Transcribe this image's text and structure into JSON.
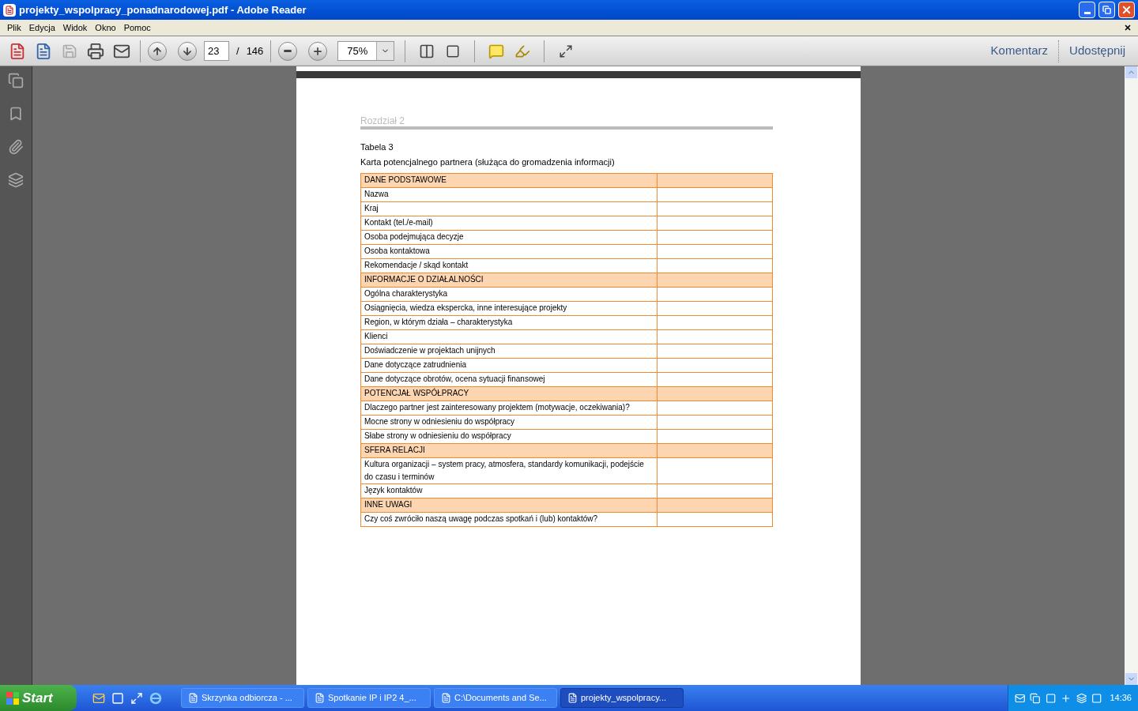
{
  "window": {
    "title": "projekty_wspolpracy_ponadnarodowej.pdf - Adobe Reader"
  },
  "menu": [
    "Plik",
    "Edycja",
    "Widok",
    "Okno",
    "Pomoc"
  ],
  "toolbar": {
    "page": "23",
    "page_separator": "/",
    "page_count": "146",
    "zoom": "75%",
    "links": [
      "Komentarz",
      "Udostępnij"
    ]
  },
  "document": {
    "chapter": "Rozdział 2",
    "table_label": "Tabela 3",
    "table_title": "Karta potencjalnego partnera (służąca do gromadzenia informacji)",
    "rows": [
      {
        "kind": "section",
        "text": "DANE PODSTAWOWE"
      },
      {
        "kind": "item",
        "text": "Nazwa"
      },
      {
        "kind": "item",
        "text": "Kraj"
      },
      {
        "kind": "item",
        "text": "Kontakt (tel./e-mail)"
      },
      {
        "kind": "item",
        "text": "Osoba podejmująca decyzje"
      },
      {
        "kind": "item",
        "text": "Osoba kontaktowa"
      },
      {
        "kind": "item",
        "text": "Rekomendacje / skąd kontakt"
      },
      {
        "kind": "section",
        "text": "INFORMACJE O DZIAŁALNOŚCI"
      },
      {
        "kind": "item",
        "text": "Ogólna charakterystyka"
      },
      {
        "kind": "item",
        "text": "Osiągnięcia, wiedza ekspercka, inne interesujące projekty"
      },
      {
        "kind": "item",
        "text": "Region, w którym działa – charakterystyka"
      },
      {
        "kind": "item",
        "text": "Klienci"
      },
      {
        "kind": "item",
        "text": "Doświadczenie w projektach unijnych"
      },
      {
        "kind": "item",
        "text": "Dane dotyczące zatrudnienia"
      },
      {
        "kind": "item",
        "text": "Dane dotyczące obrotów, ocena sytuacji finansowej"
      },
      {
        "kind": "section",
        "text": "POTENCJAŁ WSPÓŁPRACY"
      },
      {
        "kind": "item",
        "text": "Dlaczego partner jest zainteresowany projektem (motywacje, oczekiwania)?"
      },
      {
        "kind": "item",
        "text": "Mocne strony w odniesieniu do współpracy"
      },
      {
        "kind": "item",
        "text": "Słabe strony w odniesieniu do współpracy"
      },
      {
        "kind": "section",
        "text": "SFERA RELACJI"
      },
      {
        "kind": "item",
        "text": "Kultura organizacji – system pracy, atmosfera, standardy komunikacji, podejście do czasu i terminów"
      },
      {
        "kind": "item",
        "text": "Język kontaktów"
      },
      {
        "kind": "section",
        "text": "INNE UWAGI"
      },
      {
        "kind": "item",
        "text": "Czy coś zwróciło naszą uwagę podczas spotkań i (lub) kontaktów?"
      }
    ]
  },
  "taskbar": {
    "start": "Start",
    "tasks": [
      {
        "label": "Skrzynka odbiorcza - ...",
        "selected": false
      },
      {
        "label": "Spotkanie IP i IP2 4_...",
        "selected": false
      },
      {
        "label": "C:\\Documents and Se...",
        "selected": false
      },
      {
        "label": "projekty_wspolpracy...",
        "selected": true
      }
    ],
    "clock": "14:36"
  }
}
